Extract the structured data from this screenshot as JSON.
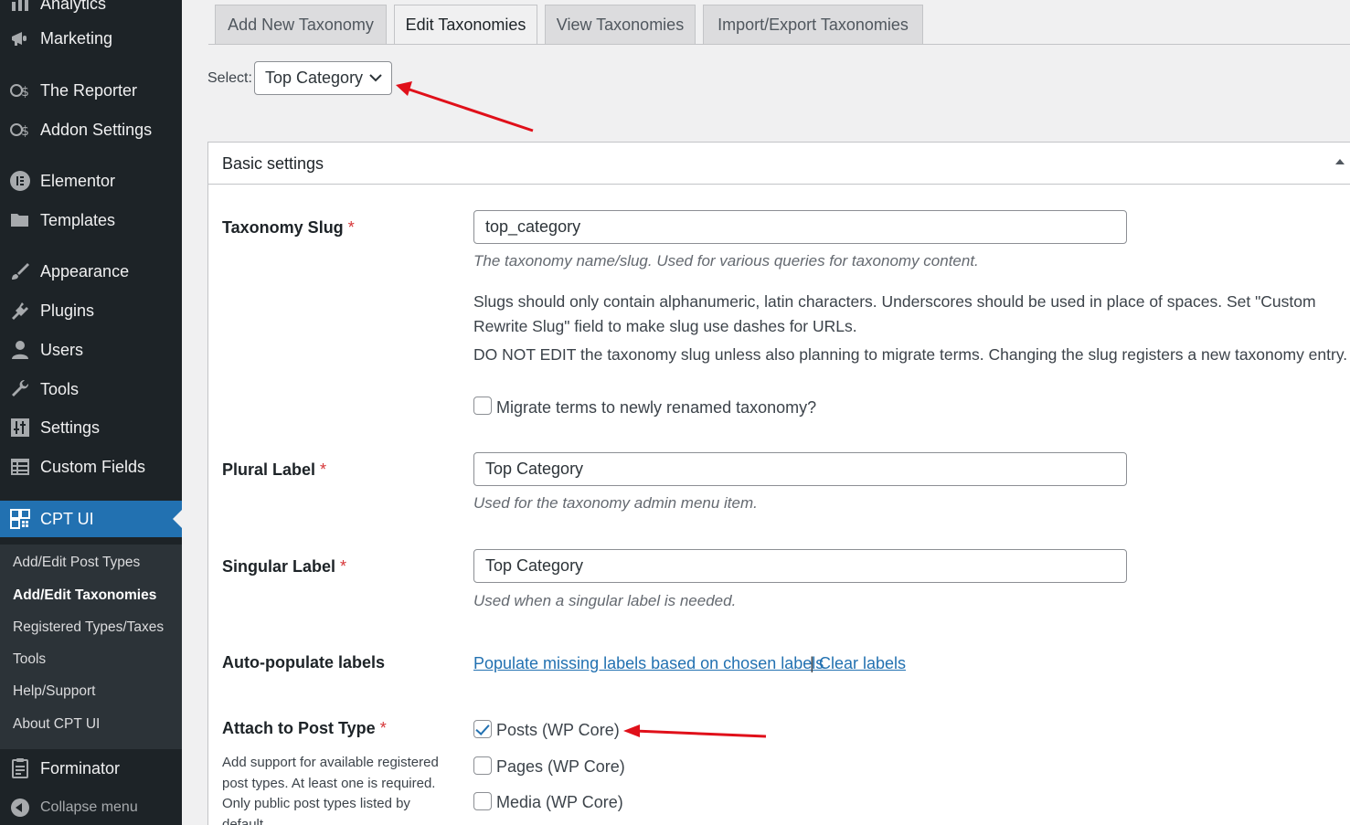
{
  "sidebar": {
    "items": [
      {
        "label": "Analytics",
        "icon": "chart-icon"
      },
      {
        "label": "Marketing",
        "icon": "megaphone-icon"
      },
      {
        "label": "The Reporter",
        "icon": "dollar-icon"
      },
      {
        "label": "Addon Settings",
        "icon": "dollar-icon"
      },
      {
        "label": "Elementor",
        "icon": "elementor-icon"
      },
      {
        "label": "Templates",
        "icon": "folder-icon"
      },
      {
        "label": "Appearance",
        "icon": "brush-icon"
      },
      {
        "label": "Plugins",
        "icon": "plugin-icon"
      },
      {
        "label": "Users",
        "icon": "user-icon"
      },
      {
        "label": "Tools",
        "icon": "wrench-icon"
      },
      {
        "label": "Settings",
        "icon": "sliders-icon"
      },
      {
        "label": "Custom Fields",
        "icon": "table-icon"
      },
      {
        "label": "CPT UI",
        "icon": "grid-icon"
      }
    ],
    "submenu": [
      "Add/Edit Post Types",
      "Add/Edit Taxonomies",
      "Registered Types/Taxes",
      "Tools",
      "Help/Support",
      "About CPT UI"
    ],
    "forminator": "Forminator",
    "collapse": "Collapse menu"
  },
  "tabs": [
    "Add New Taxonomy",
    "Edit Taxonomies",
    "View Taxonomies",
    "Import/Export Taxonomies"
  ],
  "select": {
    "label": "Select:",
    "value": "Top Category"
  },
  "panel": {
    "title": "Basic settings",
    "slug": {
      "label": "Taxonomy Slug",
      "value": "top_category",
      "desc": "The taxonomy name/slug. Used for various queries for taxonomy content.",
      "note1": "Slugs should only contain alphanumeric, latin characters. Underscores should be used in place of spaces. Set \"Custom Rewrite Slug\" field to make slug use dashes for URLs.",
      "note2": "DO NOT EDIT the taxonomy slug unless also planning to migrate terms. Changing the slug registers a new taxonomy entry.",
      "migrate": "Migrate terms to newly renamed taxonomy?"
    },
    "plural": {
      "label": "Plural Label",
      "value": "Top Category",
      "desc": "Used for the taxonomy admin menu item."
    },
    "singular": {
      "label": "Singular Label",
      "value": "Top Category",
      "desc": "Used when a singular label is needed."
    },
    "autopop": {
      "label": "Auto-populate labels",
      "populate": "Populate missing labels based on chosen labels",
      "sep": "|",
      "clear": "Clear labels"
    },
    "attach": {
      "label": "Attach to Post Type",
      "desc": "Add support for available registered post types. At least one is required. Only public post types listed by default.",
      "options": [
        {
          "label": "Posts (WP Core)",
          "checked": true
        },
        {
          "label": "Pages (WP Core)",
          "checked": false
        },
        {
          "label": "Media (WP Core)",
          "checked": false
        }
      ]
    },
    "required_mark": "*"
  },
  "colors": {
    "sidebar_bg": "#1d2327",
    "accent": "#2271b1",
    "annotation": "#e0101a"
  }
}
